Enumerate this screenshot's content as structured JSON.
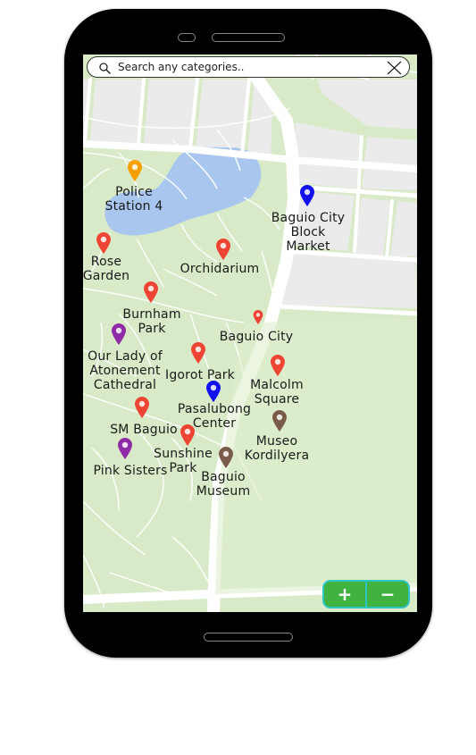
{
  "search": {
    "placeholder": "Search any categories.."
  },
  "zoom": {
    "in_label": "+",
    "out_label": "−"
  },
  "colors": {
    "park": "#d8eac7",
    "lake": "#a8c6ee",
    "blocks": "#ebebeb",
    "roads": "#ffffff",
    "pin_red": "#ee4433",
    "pin_orange": "#f5a000",
    "pin_blue": "#1111ee",
    "pin_purple": "#8e2aa6",
    "pin_brown": "#7a5a48",
    "zoom_bg": "#3fb23f",
    "zoom_border": "#2ec4c4"
  },
  "places": [
    {
      "name": "Police Station 4",
      "label": "Police\nStation 4",
      "color": "orange"
    },
    {
      "name": "Baguio City Block Market",
      "label": "Baguio City\nBlock\nMarket",
      "color": "blue"
    },
    {
      "name": "Rose Garden",
      "label": "Rose\nGarden",
      "color": "red"
    },
    {
      "name": "Orchidarium",
      "label": "Orchidarium",
      "color": "red"
    },
    {
      "name": "Burnham Park",
      "label": "Burnham\nPark",
      "color": "red"
    },
    {
      "name": "Baguio City",
      "label": "Baguio City",
      "color": "red"
    },
    {
      "name": "Our Lady of Atonement Cathedral",
      "label": "Our Lady of\nAtonement\nCathedral",
      "color": "purple"
    },
    {
      "name": "Igorot Park",
      "label": "Igorot Park",
      "color": "red"
    },
    {
      "name": "Malcolm Square",
      "label": "Malcolm\nSquare",
      "color": "red"
    },
    {
      "name": "Pasalubong Center",
      "label": "Pasalubong\nCenter",
      "color": "blue"
    },
    {
      "name": "SM Baguio",
      "label": "SM Baguio",
      "color": "red"
    },
    {
      "name": "Museo Kordilyera",
      "label": "Museo\nKordilyera",
      "color": "brown"
    },
    {
      "name": "Sunshine Park",
      "label": "Sunshine\nPark",
      "color": "red"
    },
    {
      "name": "Pink Sisters",
      "label": "Pink Sisters",
      "color": "purple"
    },
    {
      "name": "Baguio Museum",
      "label": "Baguio\nMuseum",
      "color": "brown"
    }
  ]
}
